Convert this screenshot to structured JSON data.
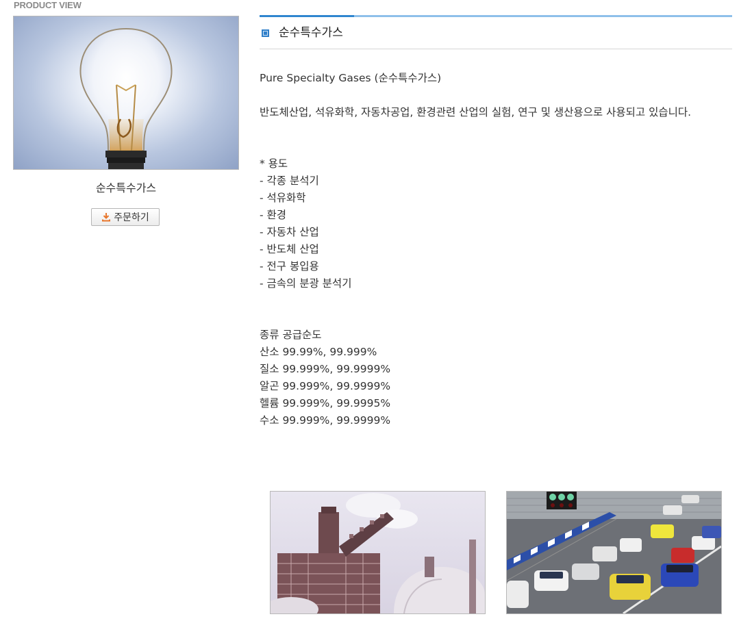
{
  "header": {
    "section_label": "PRODUCT VIEW"
  },
  "product": {
    "image_icon": "light-bulb-image",
    "name": "순수특수가스",
    "order_button_label": "주문하기",
    "order_button_icon": "download-icon"
  },
  "detail": {
    "title": "순수특수가스",
    "intro": "Pure Specialty Gases (순수특수가스)",
    "description": "반도체산업, 석유화학, 자동차공업, 환경관련 산업의 실험, 연구 및 생산용으로 사용되고 있습니다.",
    "uses_heading": "* 용도",
    "uses": [
      "- 각종 분석기",
      "- 석유화학",
      "- 환경",
      "- 자동차 산업",
      "- 반도체 산업",
      "- 전구 봉입용",
      "- 금속의 분광 분석기"
    ],
    "purity_heading": "종류 공급순도",
    "purities": [
      "산소 99.99%, 99.999%",
      "질소 99.999%, 99.9999%",
      "알곤 99.999%, 99.9999%",
      "헬륨 99.999%, 99.9995%",
      "수소 99.999%, 99.9999%"
    ]
  },
  "photos": {
    "left_icon": "industrial-plant-image",
    "right_icon": "racing-cars-image"
  },
  "colors": {
    "accent_blue": "#2f86cf",
    "light_blue": "#8ec0ea",
    "text": "#333333",
    "label_gray": "#8a8a8a"
  }
}
